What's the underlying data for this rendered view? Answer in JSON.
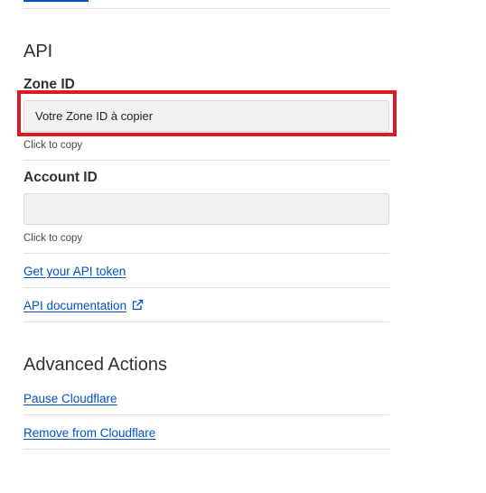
{
  "api_section": {
    "title": "API",
    "zone_id": {
      "label": "Zone ID",
      "value": "Votre Zone ID à copier",
      "hint": "Click to copy"
    },
    "account_id": {
      "label": "Account ID",
      "value": "",
      "hint": "Click to copy"
    },
    "links": {
      "api_token": "Get your API token",
      "api_docs": "API documentation"
    }
  },
  "advanced_section": {
    "title": "Advanced Actions",
    "links": {
      "pause": "Pause Cloudflare",
      "remove": "Remove from Cloudflare"
    }
  },
  "icons": {
    "external_link": "external-link-icon"
  },
  "colors": {
    "link": "#0051c3",
    "highlight": "#e0191f",
    "field_bg": "#f2f2f2",
    "divider": "#e0e0e0",
    "text": "#313131"
  }
}
